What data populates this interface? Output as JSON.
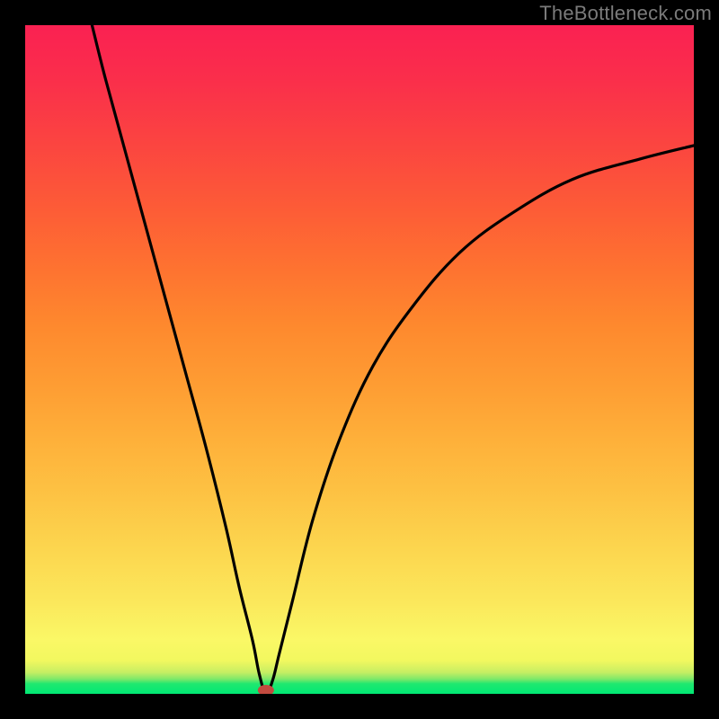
{
  "watermark": "TheBottleneck.com",
  "colors": {
    "frame_bg": "#000000",
    "curve_stroke": "#000000",
    "min_marker": "#c24a3f",
    "gradient_top": "#fa2152",
    "gradient_bottom": "#00e874"
  },
  "chart_data": {
    "type": "line",
    "title": "",
    "xlabel": "",
    "ylabel": "",
    "xlim": [
      0,
      100
    ],
    "ylim": [
      0,
      100
    ],
    "min_point": {
      "x": 36,
      "y": 0
    },
    "series": [
      {
        "name": "bottleneck-curve",
        "x": [
          10,
          12,
          15,
          18,
          21,
          24,
          27,
          30,
          32,
          34,
          35,
          36,
          37,
          38,
          40,
          43,
          47,
          52,
          58,
          65,
          73,
          82,
          92,
          100
        ],
        "y": [
          100,
          92,
          81,
          70,
          59,
          48,
          37,
          25,
          16,
          8,
          3,
          0,
          2,
          6,
          14,
          26,
          38,
          49,
          58,
          66,
          72,
          77,
          80,
          82
        ]
      }
    ],
    "annotations": []
  }
}
